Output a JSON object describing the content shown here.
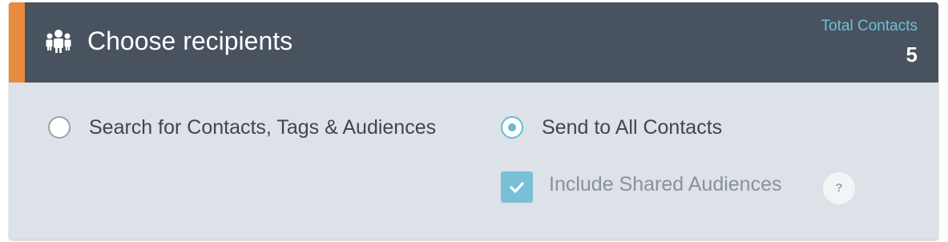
{
  "header": {
    "title": "Choose recipients",
    "icon": "people-icon",
    "total_label": "Total Contacts",
    "total_value": "5",
    "accent_color": "#e88b3c",
    "background_color": "#49525f"
  },
  "options": [
    {
      "label": "Search for Contacts, Tags & Audiences",
      "selected": false
    },
    {
      "label": "Send to All Contacts",
      "selected": true
    }
  ],
  "include_shared": {
    "label": "Include Shared Audiences",
    "checked": true,
    "help_text": "?"
  },
  "colors": {
    "link": "#6cc1d8",
    "radio_active": "#66bcd3",
    "checkbox": "#79c0d6",
    "panel_body": "#dde1e8"
  }
}
